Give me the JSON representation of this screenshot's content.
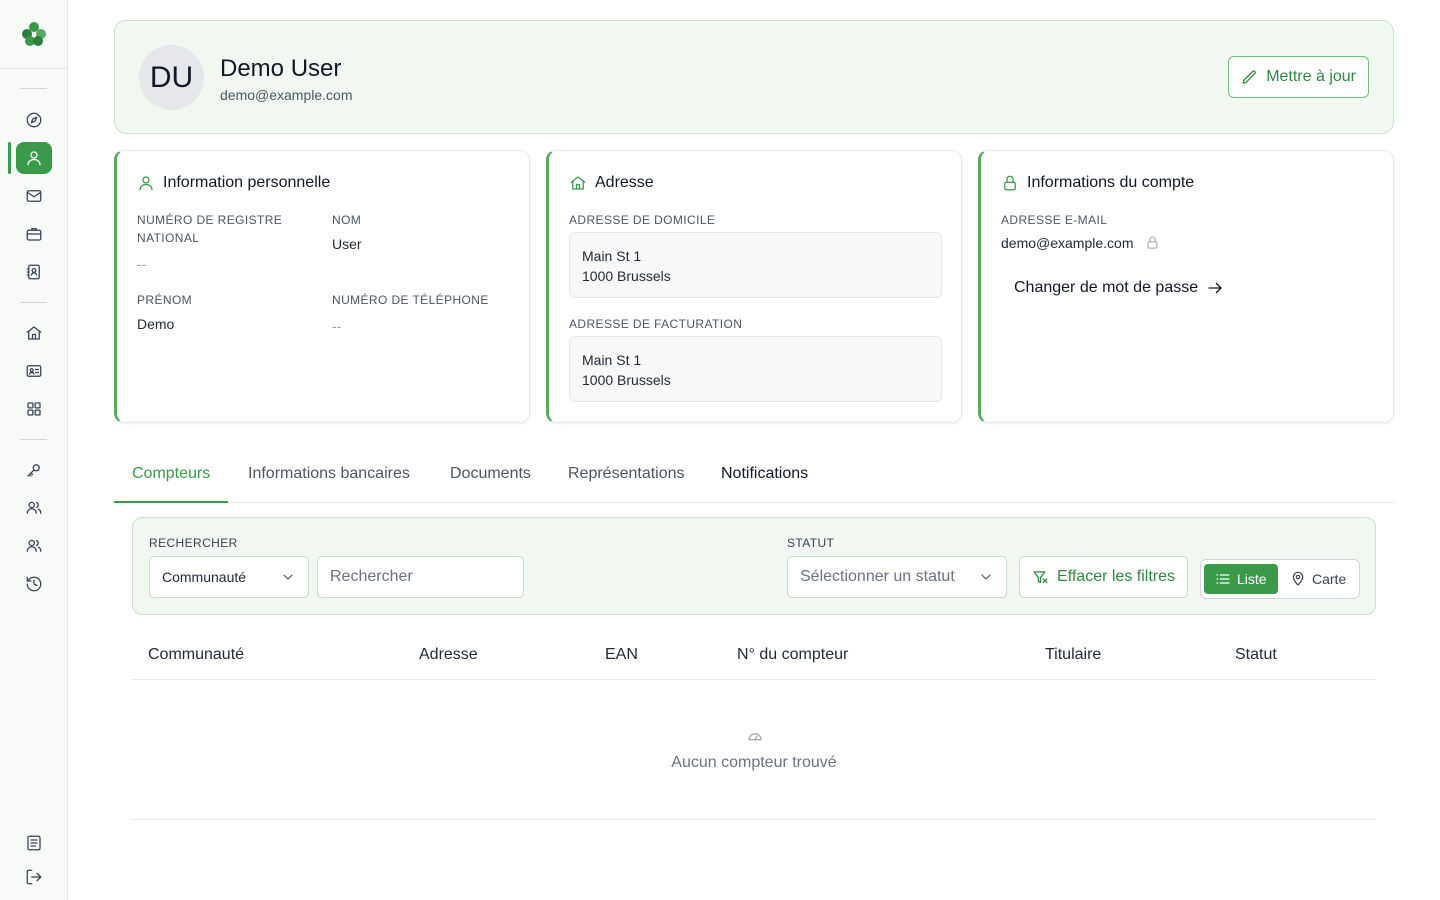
{
  "profile": {
    "initials": "DU",
    "name": "Demo User",
    "email": "demo@example.com",
    "update_button": "Mettre à jour"
  },
  "personal": {
    "title": "Information personnelle",
    "national_register_label": "Numéro de registre national",
    "national_register_value": "--",
    "last_name_label": "Nom",
    "last_name_value": "User",
    "first_name_label": "Prénom",
    "first_name_value": "Demo",
    "phone_label": "Numéro de téléphone",
    "phone_value": "--"
  },
  "address": {
    "title": "Adresse",
    "home_label": "Adresse de domicile",
    "home_line1": "Main St 1",
    "home_line2": "1000 Brussels",
    "billing_label": "Adresse de facturation",
    "billing_line1": "Main St 1",
    "billing_line2": "1000 Brussels"
  },
  "account": {
    "title": "Informations du compte",
    "email_label": "Adresse e-mail",
    "email_value": "demo@example.com",
    "change_password": "Changer de mot de passe"
  },
  "tabs": [
    {
      "label": "Compteurs"
    },
    {
      "label": "Informations bancaires"
    },
    {
      "label": "Documents"
    },
    {
      "label": "Représentations"
    },
    {
      "label": "Notifications"
    }
  ],
  "filters": {
    "search_label": "Rechercher",
    "search_field_value": "Communauté",
    "search_placeholder": "Rechercher",
    "status_label": "Statut",
    "status_placeholder": "Sélectionner un statut",
    "clear_button": "Effacer les filtres",
    "view_list": "Liste",
    "view_map": "Carte"
  },
  "table": {
    "columns": [
      "Communauté",
      "Adresse",
      "EAN",
      "N° du compteur",
      "Titulaire",
      "Statut"
    ],
    "empty_text": "Aucun compteur trouvé"
  },
  "colors": {
    "accent": "#3a9a4a",
    "accent_light_bg": "#f1f8f1",
    "accent_border": "#c7e3c9"
  }
}
